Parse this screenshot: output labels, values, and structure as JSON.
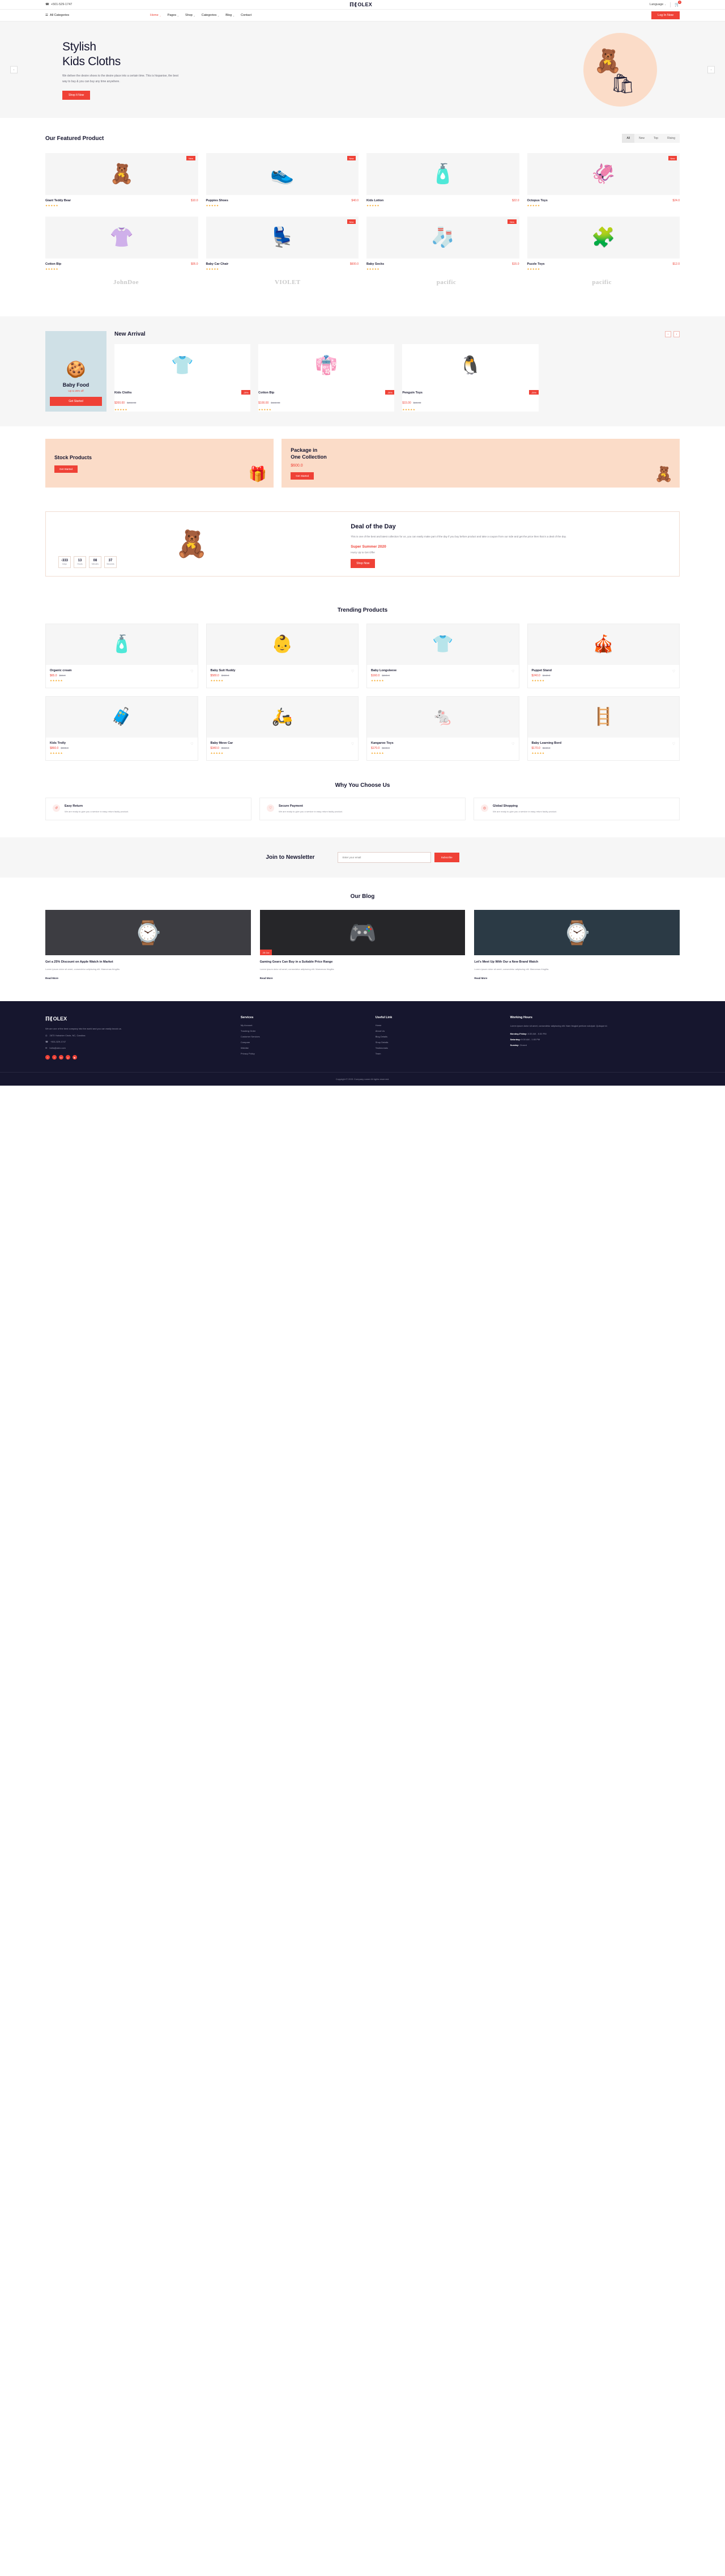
{
  "topbar": {
    "phone": "+501-529-1747",
    "phone_icon": "phone-icon",
    "language": "Language",
    "cart_icon": "cart-icon",
    "cart_count": "0"
  },
  "brand": {
    "name": "OLEX",
    "mark": "X"
  },
  "nav": {
    "all_categories": "All Categories",
    "items": [
      {
        "label": "Home",
        "caret": "˅",
        "active": true
      },
      {
        "label": "Pages",
        "caret": "˅",
        "active": false
      },
      {
        "label": "Shop",
        "caret": "˅",
        "active": false
      },
      {
        "label": "Categories",
        "caret": "˅",
        "active": false
      },
      {
        "label": "Blog",
        "caret": "˅",
        "active": false
      },
      {
        "label": "Contact",
        "caret": "",
        "active": false
      }
    ],
    "login": "Log In Now"
  },
  "hero": {
    "title_line1": "Stylish",
    "title_line2": "Kids Cloths",
    "paragraph": "We deliver the desire shoes to the desire place into a certain time. This is hispanise, the best way to buy & you can buy any time anywhere.",
    "cta": "Shop It Now",
    "prev": "‹",
    "next": "›"
  },
  "featured": {
    "title": "Our Featured Product",
    "tabs": [
      "All",
      "New",
      "Top",
      "Rising"
    ],
    "active_tab": "All",
    "products": [
      {
        "name": "Giant Teddy Bear",
        "price": "$10.0",
        "badge": "New",
        "stars": "★★★★★",
        "art": "🧸"
      },
      {
        "name": "Puppies Shoes",
        "price": "$40.0",
        "badge": "New",
        "stars": "★★★★★",
        "art": "👟"
      },
      {
        "name": "Kids Lotion",
        "price": "$22.0",
        "badge": "",
        "stars": "★★★★★",
        "art": "🧴"
      },
      {
        "name": "Octopus Toys",
        "price": "$24.0",
        "badge": "New",
        "stars": "★★★★★",
        "art": "🦑"
      },
      {
        "name": "Cotton Bip",
        "price": "$05.0",
        "badge": "",
        "stars": "★★★★★",
        "art": "👚"
      },
      {
        "name": "Baby Car Chair",
        "price": "$600.0",
        "badge": "New",
        "stars": "★★★★★",
        "art": "💺"
      },
      {
        "name": "Baby Socks",
        "price": "$15.0",
        "badge": "New",
        "stars": "★★★★★",
        "art": "🧦"
      },
      {
        "name": "Puzzle Toys",
        "price": "$12.0",
        "badge": "",
        "stars": "★★★★★",
        "art": "🧩"
      }
    ]
  },
  "brands": [
    "JohnDoe",
    "VIOLET",
    "pacific",
    "pacific"
  ],
  "arrivals": {
    "title": "New Arrival",
    "prev": "‹",
    "next": "›",
    "promo": {
      "title": "Baby Food",
      "sub": "Up to 25% off",
      "cta": "Get Started",
      "art": "🍪"
    },
    "products": [
      {
        "name": "Kids Cloths",
        "badge": "-25%",
        "price": "$200.00",
        "old": "$250.00",
        "stars": "★★★★★",
        "art": "👕"
      },
      {
        "name": "Cotton Bip",
        "badge": "-25%",
        "price": "$100.00",
        "old": "$150.00",
        "stars": "★★★★★",
        "art": "👘"
      },
      {
        "name": "Penguin Toys",
        "badge": "-25%",
        "price": "$15.00",
        "old": "$20.00",
        "stars": "★★★★★",
        "art": "🐧"
      }
    ]
  },
  "banners": [
    {
      "title": "Stock Products",
      "title2": "",
      "price": "",
      "cta": "Get Started",
      "art": "🎁"
    },
    {
      "title": "Package in",
      "title2": "One Collection",
      "price": "$600.0",
      "cta": "Get Started",
      "art": "🧸"
    }
  ],
  "deal": {
    "art": "🧸",
    "title": "Deal of the Day",
    "paragraph": "This is one of the best and latest collection for us, you can easily make part of the day if you buy before product and take a coupon from our side and get the price then that is a deal of the day.",
    "highlight": "Super Summer 2020",
    "small": "Hurry Up to Get Offer",
    "cta": "Shop Now",
    "counters": [
      {
        "n": "-333",
        "l": "Days"
      },
      {
        "n": "13",
        "l": "Hours"
      },
      {
        "n": "08",
        "l": "Minutes"
      },
      {
        "n": "37",
        "l": "Seconds"
      }
    ]
  },
  "trending": {
    "title": "Trending Products",
    "heart_icon": "heart-icon",
    "products": [
      {
        "name": "Organic cream",
        "price": "$65.0",
        "old": "$68.0",
        "stars": "★★★★★",
        "art": "🧴"
      },
      {
        "name": "Baby Suit Huddy",
        "price": "$580.0",
        "old": "$680.0",
        "stars": "★★★★★",
        "art": "👶"
      },
      {
        "name": "Baby Longsleeve",
        "price": "$160.0",
        "old": "$220.0",
        "stars": "★★★★★",
        "art": "👕"
      },
      {
        "name": "Puppet Stand",
        "price": "$240.0",
        "old": "$440.0",
        "stars": "★★★★★",
        "art": "🎪"
      },
      {
        "name": "Kids Trolly",
        "price": "$860.0",
        "old": "$900.0",
        "stars": "★★★★★",
        "art": "🧳"
      },
      {
        "name": "Baby Move Car",
        "price": "$340.0",
        "old": "$560.0",
        "stars": "★★★★★",
        "art": "🛵"
      },
      {
        "name": "Kangaroo Toys",
        "price": "$170.0",
        "old": "$240.0",
        "stars": "★★★★★",
        "art": "🐁"
      },
      {
        "name": "Baby Learning Bord",
        "price": "$170.0",
        "old": "$240.0",
        "stars": "★★★★★",
        "art": "🪜"
      }
    ]
  },
  "why": {
    "title": "Why You Choose Us",
    "cards": [
      {
        "icon": "refresh-icon",
        "glyph": "↺",
        "title": "Easy Return",
        "desc": "We are ready to give you a service in easy return faulty product."
      },
      {
        "icon": "shield-icon",
        "glyph": "♡",
        "title": "Secure Payment",
        "desc": "We are ready to give you a service in easy return faulty product."
      },
      {
        "icon": "globe-icon",
        "glyph": "◎",
        "title": "Global Shopping",
        "desc": "We are ready to give you a service in easy return faulty product."
      }
    ]
  },
  "newsletter": {
    "title": "Join to Newsletter",
    "placeholder": "Enter your email",
    "value": "",
    "button": "Subscribe"
  },
  "blog": {
    "title": "Our Blog",
    "posts": [
      {
        "tag": "",
        "art": "⌚",
        "title": "Get a 25% Discount on Apple Watch in Market",
        "desc": "Lorem ipsum dolor sit amet, consectetur adipiscing elit. Maecenas fringilla.",
        "more": "Read More"
      },
      {
        "tag": "25 Oct",
        "art": "🎮",
        "title": "Gaming Gears Can Buy in a Suitable Price Range",
        "desc": "Lorem ipsum dolor sit amet, consectetur adipiscing elit. Maecenas fringilla.",
        "more": "Read More"
      },
      {
        "tag": "",
        "art": "⌚",
        "title": "Let's Meet Up With Our a New Brand Watch",
        "desc": "Lorem ipsum dolor sit amet, consectetur adipiscing elit. Maecenas fringilla.",
        "more": "Read More"
      }
    ]
  },
  "footer": {
    "brand": "OLEX",
    "desc": "We are one of the best company into the world and you can easily knock us.",
    "address": "2873 Yorkshire Circle, NC, Carolina",
    "phone": "+501-529-1747",
    "email": "hello@olex.com",
    "address_icon": "location-icon",
    "phone_icon": "phone-icon",
    "email_icon": "mail-icon",
    "socials": [
      "f",
      "t",
      "in",
      "p",
      "▶"
    ],
    "columns": [
      {
        "head": "Services",
        "items": [
          "My Account",
          "Tracking Order",
          "Customer Services",
          "Compare",
          "Wishlist",
          "Privacy Policy"
        ]
      },
      {
        "head": "Useful Link",
        "items": [
          "Home",
          "About Us",
          "Blog Details",
          "Shop Details",
          "Testimonials",
          "Team"
        ]
      }
    ],
    "hours": {
      "head": "Working Hours",
      "desc": "Lorem ipsum dolor sit amet, consectetur adipiscing elit. Nam feugiat pretium volutpat. Quisque id.",
      "lines": [
        {
          "label": "Monday-Friday:",
          "value": "8:30 AM - 5:30 PM"
        },
        {
          "label": "Saturday:",
          "value": "9:00 AM - 1:00 PM"
        },
        {
          "label": "Sunday:",
          "value": "Closed"
        }
      ]
    },
    "copyright": "Copyright © 2021 Company name All rights reserved."
  }
}
